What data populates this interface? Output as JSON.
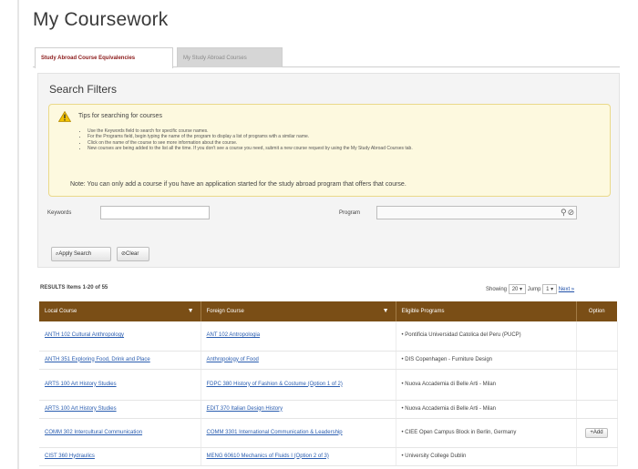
{
  "page": {
    "title": "My Coursework"
  },
  "tabs": [
    {
      "label": "Study Abroad Course Equivalencies",
      "active": true
    },
    {
      "label": "My Study Abroad Courses",
      "active": false
    }
  ],
  "filters": {
    "title": "Search Filters",
    "tips_heading": "Tips for searching for courses",
    "tips": [
      "Use the Keywords field to search for specific course names.",
      "For the Programs field, begin typing the name of the program to display a list of programs with a similar name.",
      "Click on the name of the course to see more information about the course.",
      "New courses are being added to the list all the time. If you don't see a course you need, submit a new course request by using the My Study Abroad Courses tab."
    ],
    "note": "Note:  You can only add a course if you have an application started for the study abroad program that offers that course.",
    "keywords_label": "Keywords",
    "keywords_value": "",
    "program_label": "Program",
    "program_value": "",
    "apply_label": "Apply Search",
    "clear_label": "Clear"
  },
  "results": {
    "summary": "RESULTS Items 1-20 of 55",
    "showing_label": "Showing",
    "showing_value": "20",
    "jump_label": "Jump",
    "jump_value": "1",
    "next_label": "Next »"
  },
  "table": {
    "headers": [
      "Local Course",
      "Foreign Course",
      "Eligible Programs",
      "Option"
    ],
    "rows": [
      {
        "local": "ANTH 102 Cultural Anthropology",
        "foreign": "ANT 102 Antropologia",
        "program": "Pontificia Universidad Catolica del Peru (PUCP)",
        "option": ""
      },
      {
        "local": "ANTH 351 Exploring Food, Drink and Place",
        "foreign": "Anthropology of Food",
        "program": "DIS Copenhagen - Furniture Design",
        "option": ""
      },
      {
        "local": "ARTS 100 Art History Studies",
        "foreign": "FDPC 380 History of Fashion & Costume (Option 1 of 2)",
        "program": "Nuova Accademia di Belle Arti - Milan",
        "option": ""
      },
      {
        "local": "ARTS 100 Art History Studies",
        "foreign": "EDIT 370 Italian Design History",
        "program": "Nuova Accademia di Belle Arti - Milan",
        "option": ""
      },
      {
        "local": "COMM 302 Intercultural Communication",
        "foreign": "COMM 3301 International Communication & Leadership",
        "program": "CIEE Open Campus Block in Berlin, Germany",
        "option": "Add"
      },
      {
        "local": "CIST 360 Hydraulics",
        "foreign": "MENG 60610 Mechanics of Fluids I (Option 2 of 3)",
        "program": "University College Dublin",
        "option": ""
      }
    ]
  },
  "colors": {
    "header_bg": "#7a4e16",
    "tab_active_text": "#8b1a1a",
    "tips_bg": "#fdf9df",
    "link": "#2a5db0"
  }
}
